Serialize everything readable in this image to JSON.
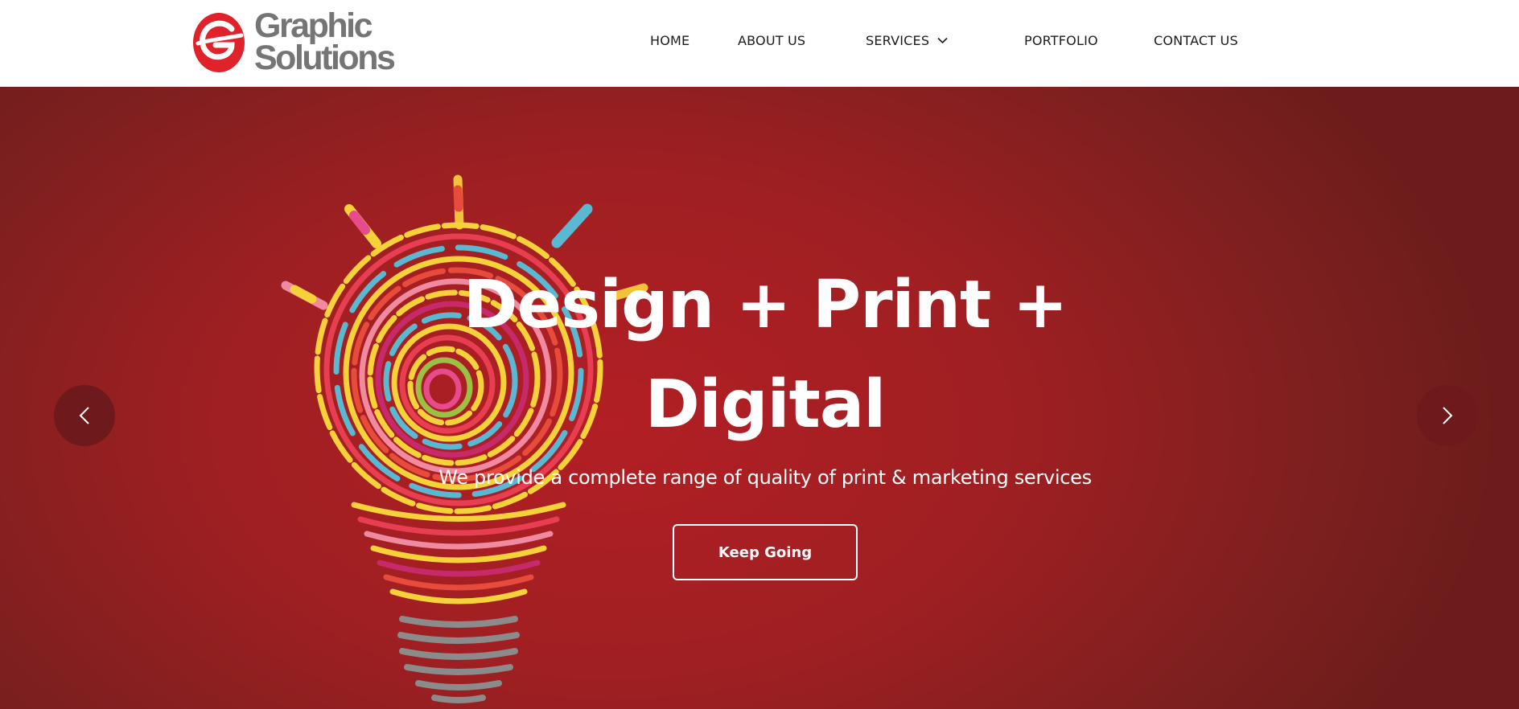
{
  "brand": {
    "name_line1": "Graphic",
    "name_line2": "Solutions",
    "accent_color": "#e0222a",
    "text_color": "#757575"
  },
  "nav": {
    "items": [
      {
        "label": "HOME"
      },
      {
        "label": "ABOUT US"
      },
      {
        "label": "SERVICES",
        "has_dropdown": true,
        "icon": "chevron-down-icon"
      },
      {
        "label": "PORTFOLIO"
      },
      {
        "label": "CONTACT US"
      }
    ]
  },
  "hero": {
    "title_line1": "Design + Print +",
    "title_line2": "Digital",
    "subtitle": "We provide a complete range of quality of print & marketing services",
    "button_label": "Keep Going",
    "background_color": "#a51f22",
    "prev_icon": "chevron-left-icon",
    "next_icon": "chevron-right-icon"
  }
}
